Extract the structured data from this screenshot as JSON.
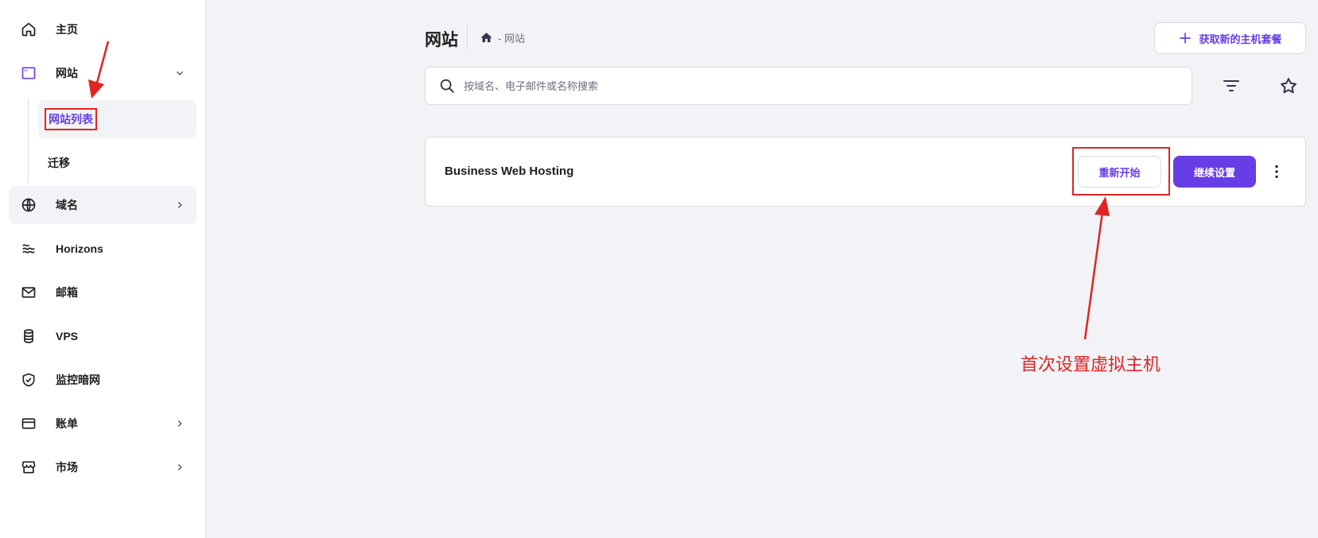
{
  "sidebar": {
    "items": [
      {
        "label": "主页",
        "icon": "home-icon"
      },
      {
        "label": "网站",
        "icon": "browser-icon",
        "chevron": "chevron-down-icon"
      },
      {
        "label": "域名",
        "icon": "globe-icon",
        "chevron": "chevron-right-icon"
      },
      {
        "label": "Horizons",
        "icon": "waves-icon"
      },
      {
        "label": "邮箱",
        "icon": "mail-icon"
      },
      {
        "label": "VPS",
        "icon": "database-icon"
      },
      {
        "label": "监控暗网",
        "icon": "shield-check-icon"
      },
      {
        "label": "账单",
        "icon": "credit-card-icon",
        "chevron": "chevron-right-icon"
      },
      {
        "label": "市场",
        "icon": "store-icon",
        "chevron": "chevron-right-icon"
      }
    ],
    "subitems": [
      {
        "label": "网站列表",
        "active": true
      },
      {
        "label": "迁移",
        "active": false
      }
    ]
  },
  "header": {
    "title": "网站",
    "breadcrumb": "- 网站",
    "get_plan_label": "获取新的主机套餐"
  },
  "search": {
    "placeholder": "按域名、电子邮件或名称搜索",
    "value": ""
  },
  "site_card": {
    "name": "Business Web Hosting",
    "restart_label": "重新开始",
    "continue_label": "继续设置"
  },
  "annotation": {
    "text": "首次设置虚拟主机",
    "color": "#e02424"
  },
  "colors": {
    "accent": "#673de6",
    "background": "#f2f3f6",
    "annotation": "#e02424"
  }
}
